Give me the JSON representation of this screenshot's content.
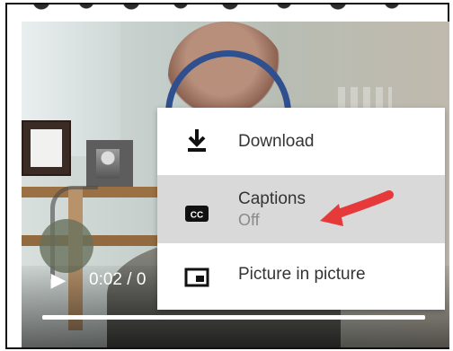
{
  "video": {
    "current_time": "0:02 / 0"
  },
  "playback": {
    "progress_percent": 100
  },
  "menu": {
    "items": [
      {
        "label": "Download",
        "icon": "download-icon"
      },
      {
        "label": "Captions",
        "sublabel": "Off",
        "icon": "closed-captions-icon"
      },
      {
        "label": "Picture in picture",
        "icon": "picture-in-picture-icon"
      }
    ]
  },
  "annotation": {
    "arrow_color": "#e63a3a"
  },
  "colors": {
    "menu_highlight": "#d9d9d9",
    "menu_text": "#343434",
    "menu_subtext": "#8a8a8a"
  }
}
